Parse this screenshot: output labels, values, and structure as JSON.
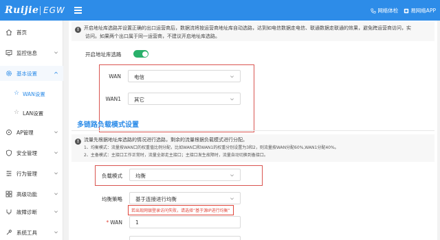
{
  "header": {
    "brand": "Ruijie",
    "product": "EGW",
    "links": [
      {
        "label": "网络体检",
        "icon": "network-check-icon"
      },
      {
        "label": "易网络APP",
        "icon": "app-icon"
      }
    ],
    "bg_color": "#2d8ce8"
  },
  "sidebar": {
    "items": [
      {
        "label": "首页",
        "icon": "home-icon"
      },
      {
        "label": "监控信息",
        "icon": "monitor-icon"
      },
      {
        "label": "基本设置",
        "icon": "settings-icon"
      },
      {
        "label": "AP管理",
        "icon": "ap-icon"
      },
      {
        "label": "安全管理",
        "icon": "shield-icon"
      },
      {
        "label": "行为管理",
        "icon": "behavior-icon"
      },
      {
        "label": "高级功能",
        "icon": "advanced-icon"
      },
      {
        "label": "故障诊断",
        "icon": "diagnose-icon"
      },
      {
        "label": "系统工具",
        "icon": "tools-icon"
      }
    ],
    "sub_items": [
      {
        "label": "WAN设置"
      },
      {
        "label": "LAN设置"
      }
    ],
    "active_color": "#2d8ce8"
  },
  "main": {
    "top_info": {
      "line1": "开启地址库选路并设置正确的出口运营商后，数据流将按运营商地址库自动选路，达到如电信数据走电信、联通数据走联通的效果，避免跨运营商访问，实",
      "line2": "访问。如果两个出口属于同一运营商，不建议开启地址库选路。"
    },
    "isp_toggle": {
      "label": "开启地址库选路",
      "on": true
    },
    "wan_rows": [
      {
        "label": "WAN",
        "value": "电信"
      },
      {
        "label": "WAN1",
        "value": "其它"
      }
    ],
    "section_title": "多链路负载模式设置",
    "lb_info": {
      "title": "流量先根据地址库选路的情况进行选路，剩余的流量根据负载模式进行分配。",
      "item1": "1、均衡模式：流量按WAN口的权重值比例分配，比如WAN口和WAN1的权重分别设置为3和2，则流量按WAN分配60%,WAN1分配40%。",
      "item2": "2、主备模式：主接口工作正常时，流量全部走主接口；主接口发生故障时，流量自动切换到备接口。"
    },
    "load_mode": {
      "label": "负载模式",
      "value": "均衡"
    },
    "balance_strategy": {
      "label": "均衡策略",
      "value": "基于连接进行均衡"
    },
    "warning": "若出现网银登录访问失败，请选择“基于源IP进行均衡”",
    "wan_weight": {
      "label": "WAN",
      "value": "1",
      "required_mark": "*"
    }
  }
}
